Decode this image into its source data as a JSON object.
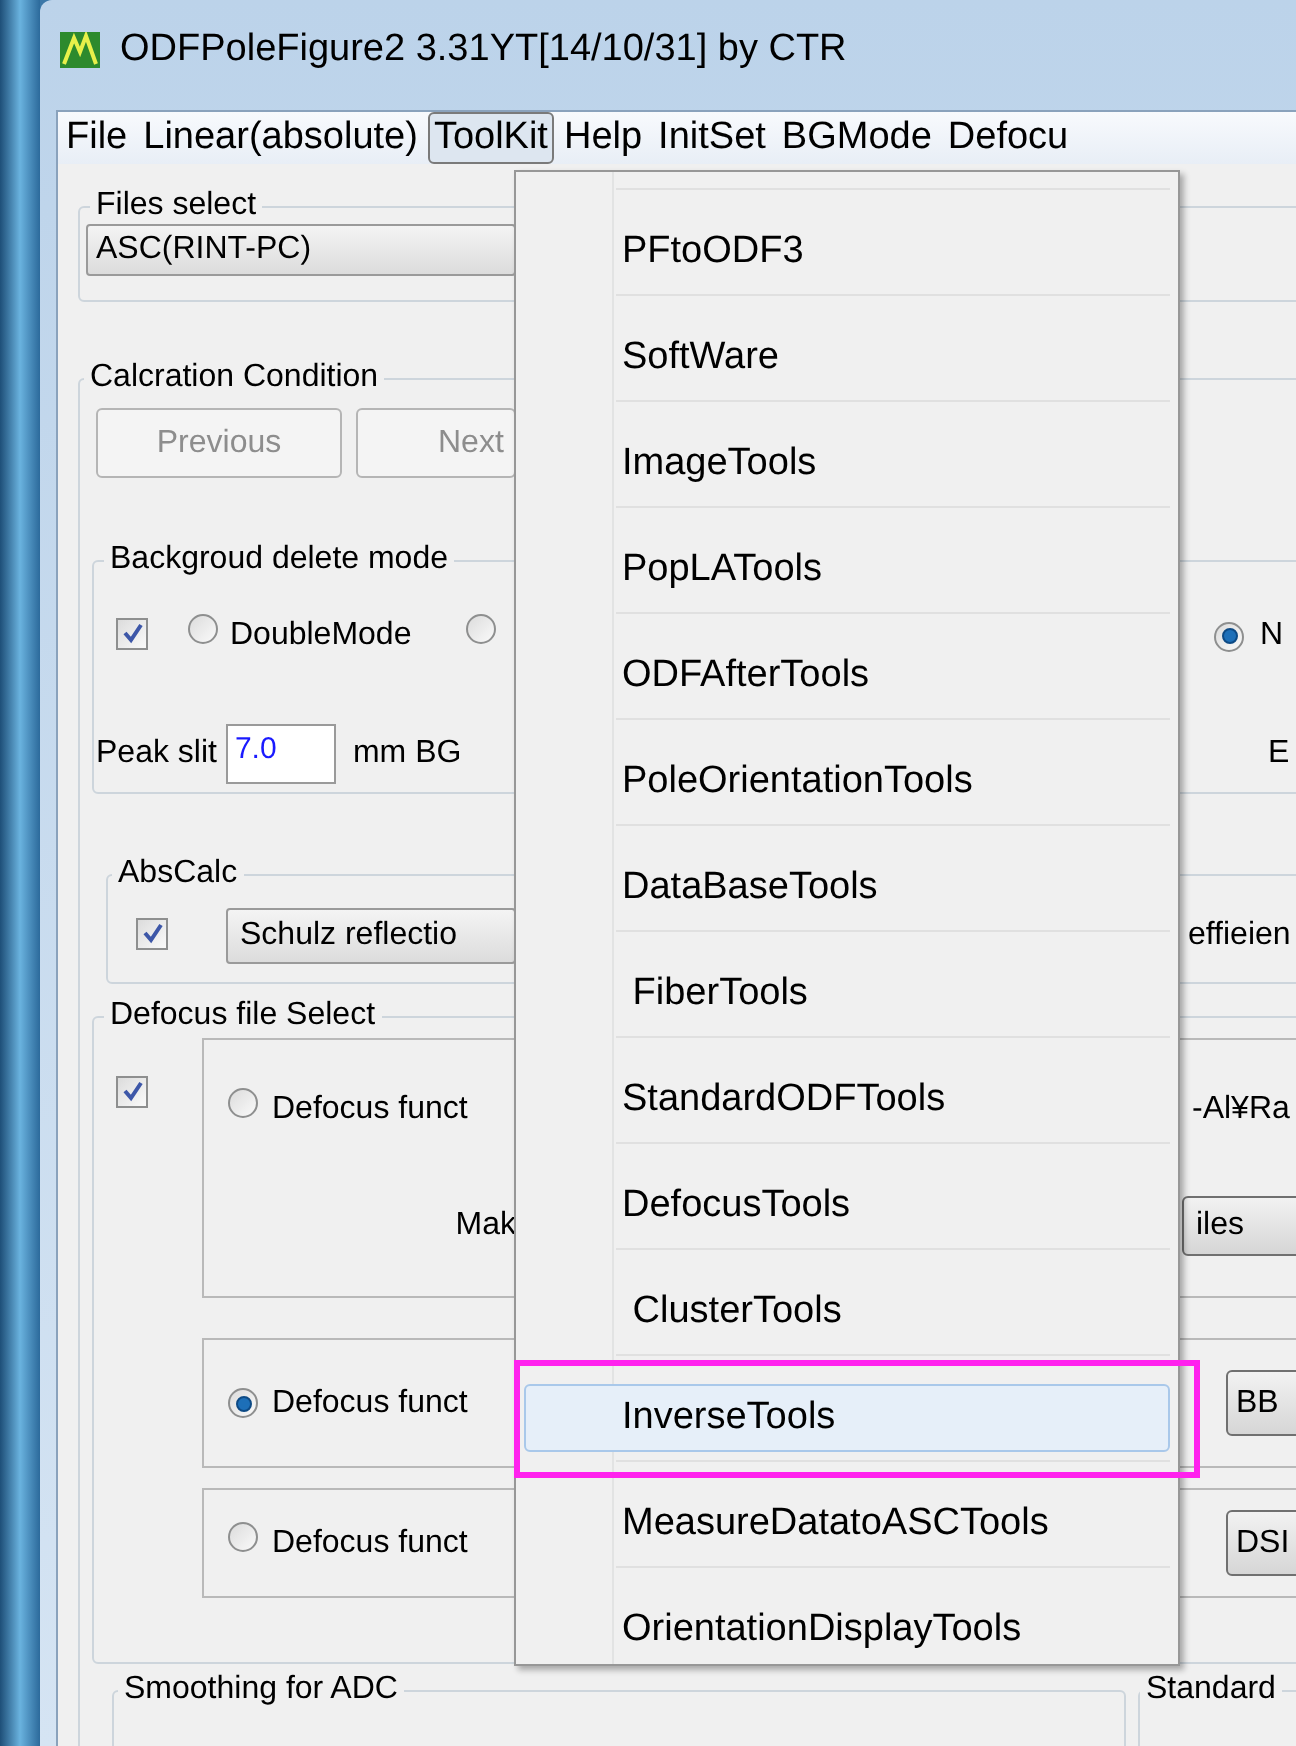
{
  "window": {
    "title": "ODFPoleFigure2 3.31YT[14/10/31] by CTR"
  },
  "menu_bar": [
    {
      "label": "File",
      "selected": false
    },
    {
      "label": "Linear(absolute)",
      "selected": false
    },
    {
      "label": "ToolKit",
      "selected": true
    },
    {
      "label": "Help",
      "selected": false
    },
    {
      "label": "InitSet",
      "selected": false
    },
    {
      "label": "BGMode",
      "selected": false
    },
    {
      "label": "Defocu",
      "selected": false
    }
  ],
  "toolkit_menu": {
    "items": [
      {
        "label": "PFtoODF3",
        "selected": false,
        "outlined": false
      },
      {
        "label": "SoftWare",
        "selected": false,
        "outlined": false
      },
      {
        "label": "ImageTools",
        "selected": false,
        "outlined": false
      },
      {
        "label": "PopLATools",
        "selected": false,
        "outlined": false
      },
      {
        "label": "ODFAfterTools",
        "selected": false,
        "outlined": false
      },
      {
        "label": "PoleOrientationTools",
        "selected": false,
        "outlined": false
      },
      {
        "label": "DataBaseTools",
        "selected": false,
        "outlined": false
      },
      {
        "label": " FiberTools",
        "selected": false,
        "outlined": false
      },
      {
        "label": "StandardODFTools",
        "selected": false,
        "outlined": false
      },
      {
        "label": "DefocusTools",
        "selected": false,
        "outlined": false
      },
      {
        "label": " ClusterTools",
        "selected": false,
        "outlined": false
      },
      {
        "label": "InverseTools",
        "selected": true,
        "outlined": true
      },
      {
        "label": "MeasureDatatoASCTools",
        "selected": false,
        "outlined": false
      },
      {
        "label": "OrientationDisplayTools",
        "selected": false,
        "outlined": false
      }
    ]
  },
  "files_select": {
    "legend": "Files select",
    "value": "ASC(RINT-PC)"
  },
  "calcration_condition": {
    "legend": "Calcration Condition",
    "buttons": [
      {
        "label": "Previous",
        "disabled": true
      },
      {
        "label": "Next",
        "disabled": true
      }
    ],
    "backgroud_delete_mode": {
      "legend": "Backgroud delete mode",
      "checked": true,
      "options": [
        {
          "label": "DoubleMode",
          "selected": false
        },
        {
          "selected": false
        },
        {
          "label": "N",
          "selected": true
        }
      ],
      "peak_slit": {
        "label": "Peak slit",
        "value": "7.0",
        "unit": "mm BG"
      },
      "cut_label": "E"
    },
    "abs_calc": {
      "legend": "AbsCalc",
      "checked": true,
      "method": "Schulz reflectio",
      "cut_label": "effieien"
    },
    "defocus_file_select": {
      "legend": "Defocus file Select",
      "checked": true,
      "options": [
        {
          "label": "Defocus funct",
          "selected": false,
          "path": "-Al¥Ra",
          "make_label": "Mak",
          "button": "iles"
        },
        {
          "label": "Defocus funct",
          "selected": true,
          "button": "BB"
        },
        {
          "label": "Defocus funct",
          "selected": false,
          "button": "DSI"
        }
      ]
    },
    "smoothing": {
      "legend": "Smoothing for ADC"
    },
    "standard": {
      "legend": "Standard"
    }
  }
}
